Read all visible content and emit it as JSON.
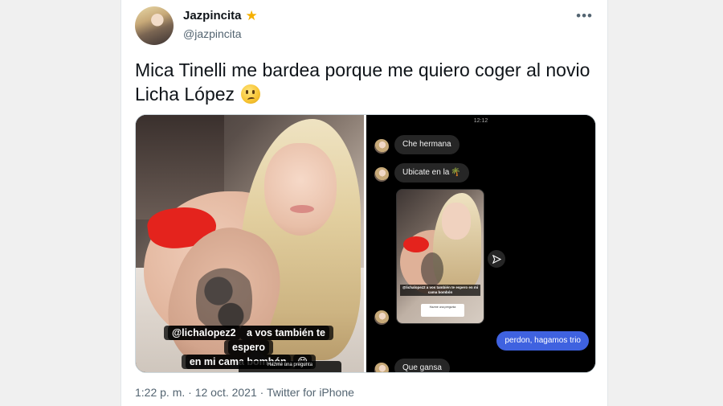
{
  "tweet": {
    "author": {
      "display_name": "Jazpincita",
      "handle": "@jazpincita",
      "verified_icon": "star-icon",
      "verified_color": "#f5b000"
    },
    "more_icon": "more-horizontal-icon",
    "text_line1": "Mica Tinelli me bardea porque me quiero coger al novio",
    "text_line2": "Licha López",
    "emoji": "face-with-rolling-eyes-emoji",
    "timestamp": "1:22 p. m. · 12 oct. 2021",
    "separator": " · ",
    "source": "Twitter for iPhone"
  },
  "media_left": {
    "mention": "@lichalopez2",
    "caption_rest": " a vos también te espero",
    "caption_line2": "en mi cama bombón",
    "caption_emoji": "😋",
    "question_label": "Hazme una pregunta"
  },
  "media_right": {
    "status_time": "12:12",
    "messages": [
      {
        "text": "Che hermana",
        "direction": "incoming"
      },
      {
        "text": "Ubicate en la",
        "emoji": "🌴",
        "direction": "incoming"
      },
      {
        "text": "perdon, hagamos trio",
        "direction": "outgoing"
      },
      {
        "text": "Que gansa",
        "direction": "incoming"
      }
    ],
    "preview_mention": "@lichalopez2 a vos también te espero en mi cama bombón",
    "preview_box": "Hazme una pregunta",
    "share_icon": "send-icon"
  },
  "colors": {
    "outgoing_bubble": "#3f62e0",
    "incoming_bubble": "#262626",
    "secondary_text": "#536471"
  }
}
